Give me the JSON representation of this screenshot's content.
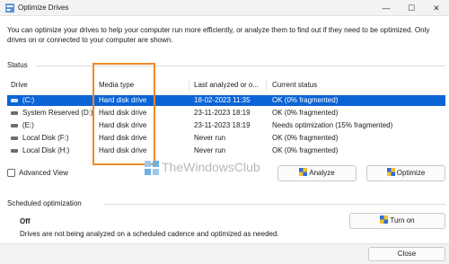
{
  "window": {
    "title": "Optimize Drives",
    "minimize": "—",
    "maximize": "☐",
    "close": "✕"
  },
  "intro": "You can optimize your drives to help your computer run more efficiently, or analyze them to find out if they need to be optimized. Only drives on or connected to your computer are shown.",
  "status": {
    "label": "Status",
    "columns": [
      "Drive",
      "Media type",
      "Last analyzed or o...",
      "Current status"
    ],
    "rows": [
      {
        "drive": "(C:)",
        "media": "Hard disk drive",
        "last": "18-02-2023 11:35",
        "status": "OK (0% fragmented)",
        "selected": true
      },
      {
        "drive": "System Reserved (D:)",
        "media": "Hard disk drive",
        "last": "23-11-2023 18:19",
        "status": "OK (0% fragmented)",
        "selected": false
      },
      {
        "drive": "(E:)",
        "media": "Hard disk drive",
        "last": "23-11-2023 18:19",
        "status": "Needs optimization (15% fragmented)",
        "selected": false
      },
      {
        "drive": "Local Disk (F:)",
        "media": "Hard disk drive",
        "last": "Never run",
        "status": "OK (0% fragmented)",
        "selected": false
      },
      {
        "drive": "Local Disk (H:)",
        "media": "Hard disk drive",
        "last": "Never run",
        "status": "OK (0% fragmented)",
        "selected": false
      }
    ]
  },
  "watermark": "TheWindowsClub",
  "advanced_view": "Advanced View",
  "buttons": {
    "analyze": "Analyze",
    "optimize": "Optimize",
    "turn_on": "Turn on",
    "close": "Close"
  },
  "scheduled": {
    "label": "Scheduled optimization",
    "state": "Off",
    "description": "Drives are not being analyzed on a scheduled cadence and optimized as needed."
  },
  "colors": {
    "selection": "#0a64d6",
    "highlight_box": "#f08a24"
  }
}
